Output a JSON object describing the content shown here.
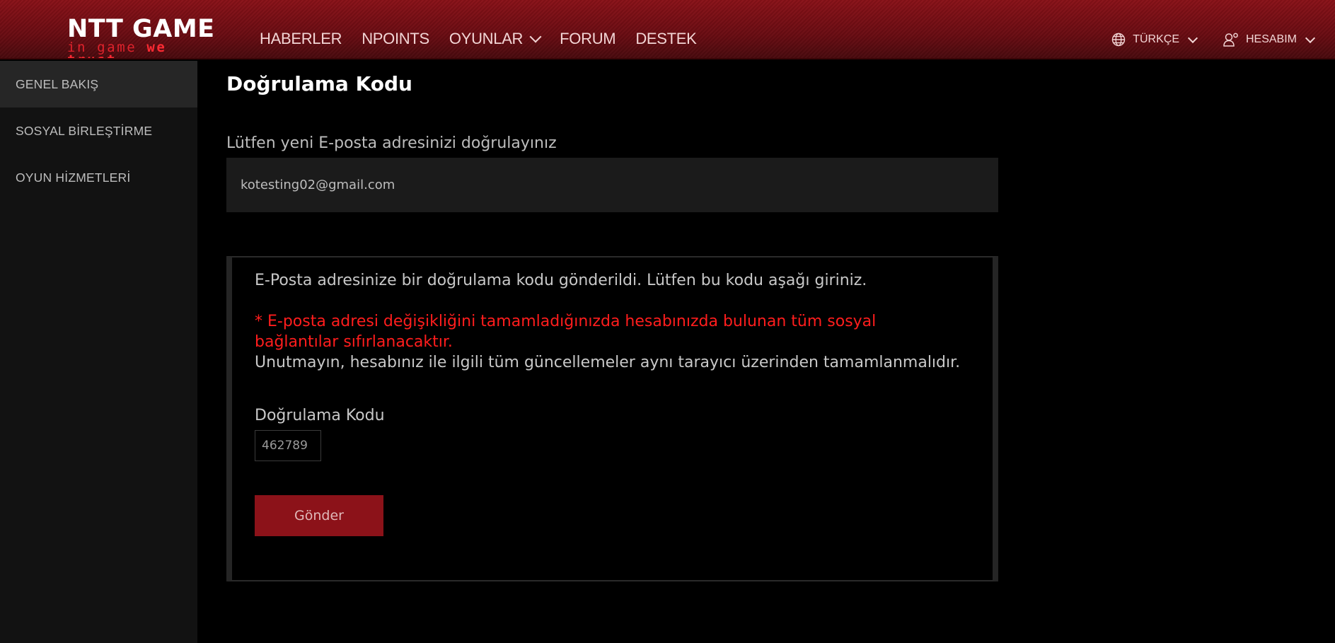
{
  "header": {
    "logo_main": "NTT GAME",
    "logo_sub_1": "in game ",
    "logo_sub_2": "we trust",
    "nav": [
      {
        "label": "HABERLER"
      },
      {
        "label": "NPOINTS"
      },
      {
        "label": "OYUNLAR"
      },
      {
        "label": "FORUM"
      },
      {
        "label": "DESTEK"
      }
    ],
    "language_label": "TÜRKÇE",
    "account_label": "HESABIM"
  },
  "sidebar": {
    "items": [
      {
        "label": "GENEL BAKIŞ"
      },
      {
        "label": "SOSYAL BİRLEŞTİRME"
      },
      {
        "label": "OYUN HİZMETLERİ"
      }
    ]
  },
  "main": {
    "title": "Doğrulama Kodu",
    "email_prompt": "Lütfen yeni E-posta adresinizi doğrulayınız",
    "email_value": "kotesting02@gmail.com",
    "panel": {
      "info": "E-Posta adresinize bir doğrulama kodu gönderildi. Lütfen bu kodu aşağı giriniz.",
      "warning": "* E-posta adresi değişikliğini tamamladığınızda hesabınızda bulunan tüm sosyal bağlantılar sıfırlanacaktır.",
      "reminder": "Unutmayın, hesabınız ile ilgili tüm güncellemeler aynı tarayıcı üzerinden tamamlanmalıdır.",
      "code_label": "Doğrulama Kodu",
      "code_value": "462789",
      "submit_label": "Gönder"
    }
  },
  "colors": {
    "header_red": "#8a1118",
    "warning_red": "#ff1d1d",
    "button_red": "#8c1219",
    "sidebar_bg": "#121212",
    "sidebar_active": "#262626"
  }
}
